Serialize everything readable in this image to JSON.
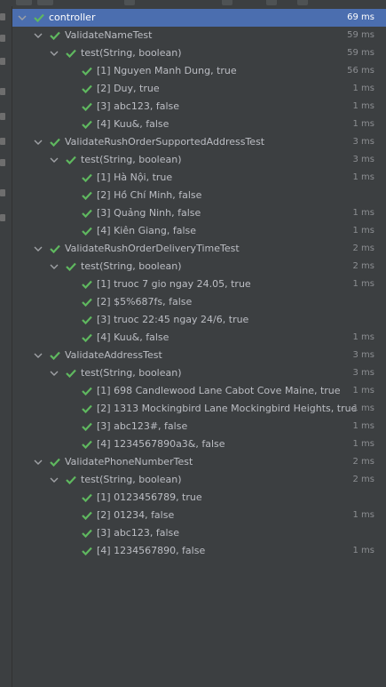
{
  "icons": {
    "expand": "chevron-down-icon",
    "pass": "checkmark-icon"
  },
  "colors": {
    "pass": "#5fb85f",
    "selected": "#4b6eaf"
  },
  "tree": {
    "root": {
      "label": "controller",
      "time": "69 ms"
    },
    "suites": [
      {
        "label": "ValidateNameTest",
        "time": "59 ms",
        "method": {
          "label": "test(String, boolean)",
          "time": "59 ms"
        },
        "cases": [
          {
            "label": "[1] Nguyen Manh Dung, true",
            "time": "56 ms"
          },
          {
            "label": "[2] Duy, true",
            "time": "1 ms"
          },
          {
            "label": "[3] abc123, false",
            "time": "1 ms"
          },
          {
            "label": "[4] Kuu&, false",
            "time": "1 ms"
          }
        ]
      },
      {
        "label": "ValidateRushOrderSupportedAddressTest",
        "time": "3 ms",
        "method": {
          "label": "test(String, boolean)",
          "time": "3 ms"
        },
        "cases": [
          {
            "label": "[1] Hà Nội, true",
            "time": "1 ms"
          },
          {
            "label": "[2] Hồ Chí Minh, false",
            "time": ""
          },
          {
            "label": "[3] Quảng Ninh, false",
            "time": "1 ms"
          },
          {
            "label": "[4] Kiên Giang, false",
            "time": "1 ms"
          }
        ]
      },
      {
        "label": "ValidateRushOrderDeliveryTimeTest",
        "time": "2 ms",
        "method": {
          "label": "test(String, boolean)",
          "time": "2 ms"
        },
        "cases": [
          {
            "label": "[1] truoc 7 gio ngay 24.05, true",
            "time": "1 ms"
          },
          {
            "label": "[2] $5%687fs, false",
            "time": ""
          },
          {
            "label": "[3] truoc 22:45 ngay 24/6, true",
            "time": ""
          },
          {
            "label": "[4] Kuu&, false",
            "time": "1 ms"
          }
        ]
      },
      {
        "label": "ValidateAddressTest",
        "time": "3 ms",
        "method": {
          "label": "test(String, boolean)",
          "time": "3 ms"
        },
        "cases": [
          {
            "label": "[1] 698 Candlewood Lane Cabot Cove Maine, true",
            "time": "1 ms"
          },
          {
            "label": "[2] 1313 Mockingbird Lane Mockingbird Heights, true",
            "time": "1 ms"
          },
          {
            "label": "[3] abc123#, false",
            "time": "1 ms"
          },
          {
            "label": "[4] 1234567890a3&, false",
            "time": "1 ms"
          }
        ]
      },
      {
        "label": "ValidatePhoneNumberTest",
        "time": "2 ms",
        "method": {
          "label": "test(String, boolean)",
          "time": "2 ms"
        },
        "cases": [
          {
            "label": "[1] 0123456789, true",
            "time": ""
          },
          {
            "label": "[2] 01234, false",
            "time": "1 ms"
          },
          {
            "label": "[3] abc123, false",
            "time": ""
          },
          {
            "label": "[4] 1234567890, false",
            "time": "1 ms"
          }
        ]
      }
    ]
  }
}
